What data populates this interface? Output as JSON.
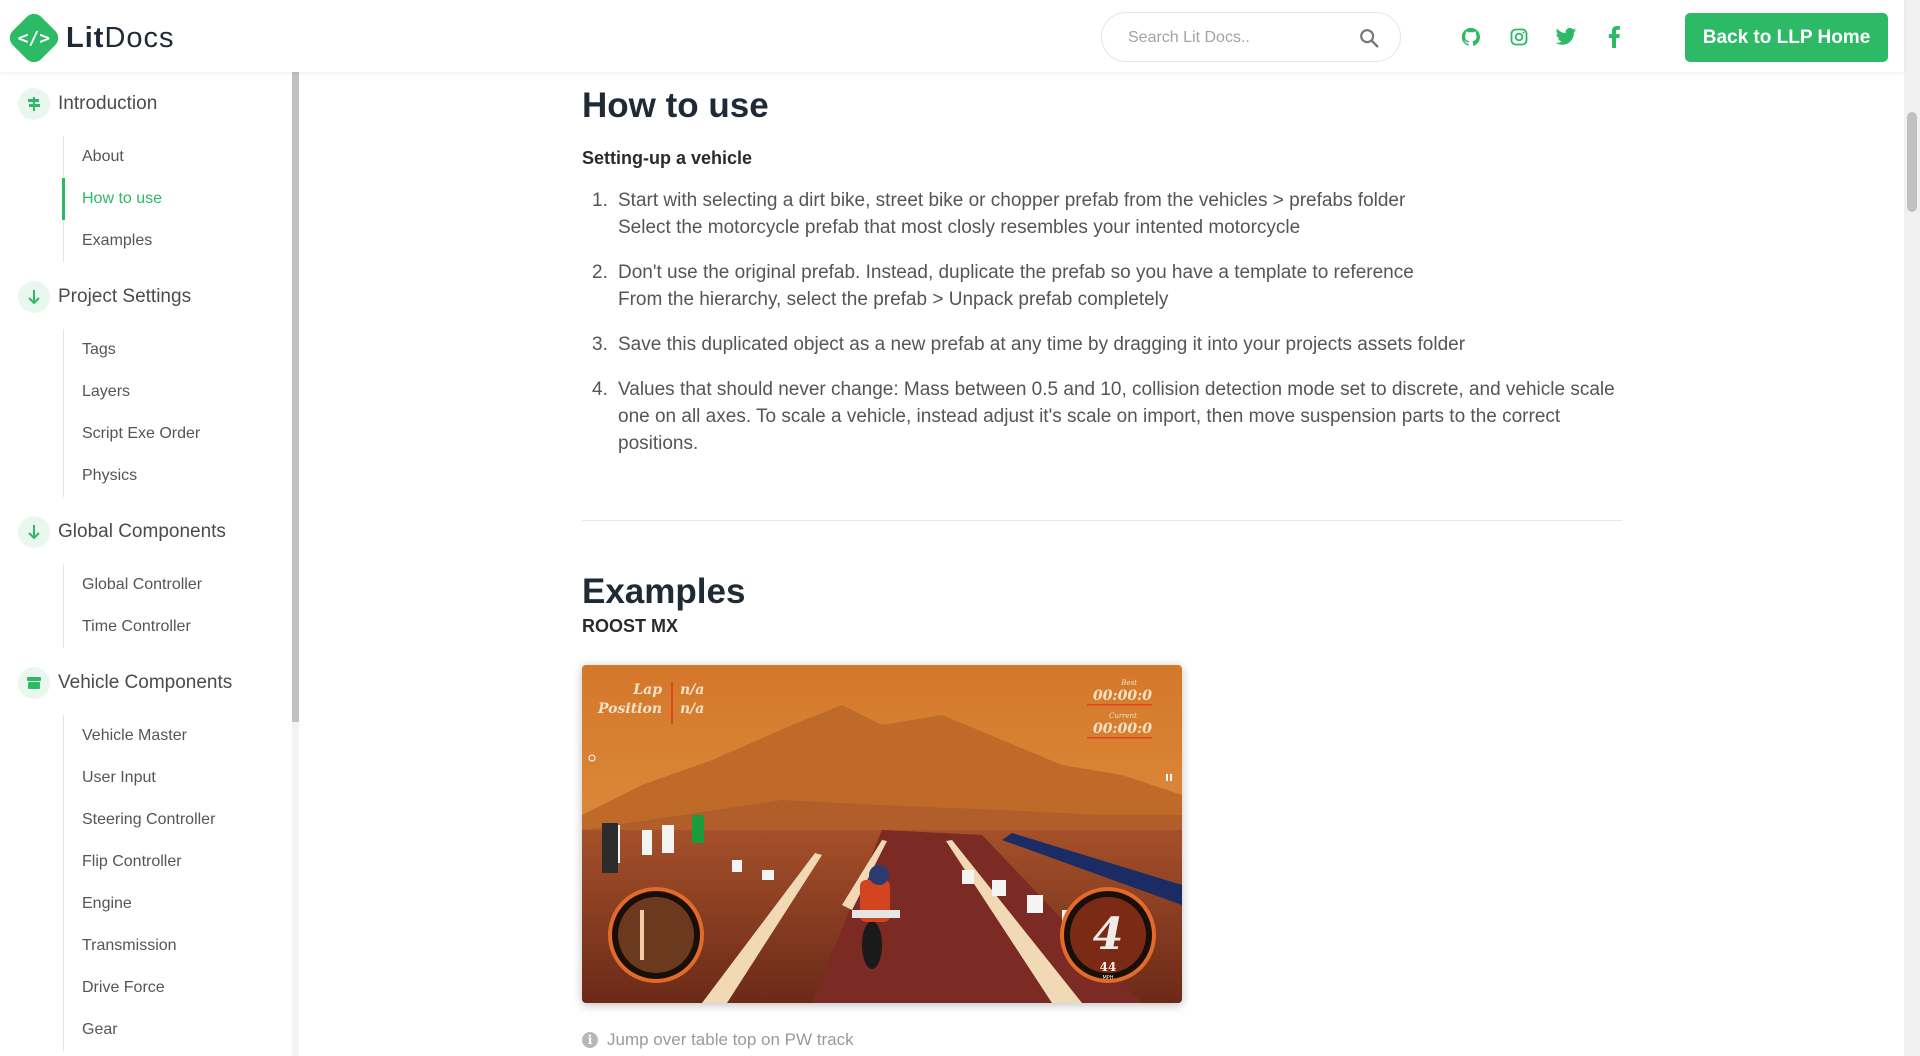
{
  "header": {
    "logo_symbol": "</>",
    "logo_bold": "Lit",
    "logo_light": "Docs",
    "search_placeholder": "Search Lit Docs..",
    "back_button": "Back to LLP Home",
    "social": [
      "github-icon",
      "instagram-icon",
      "twitter-icon",
      "facebook-icon"
    ],
    "accent": "#2cba66"
  },
  "sidebar": {
    "sections": [
      {
        "label": "Introduction",
        "icon": "signpost-icon",
        "items": [
          "About",
          "How to use",
          "Examples"
        ],
        "active_item": "How to use"
      },
      {
        "label": "Project Settings",
        "icon": "arrow-down-icon",
        "items": [
          "Tags",
          "Layers",
          "Script Exe Order",
          "Physics"
        ]
      },
      {
        "label": "Global Components",
        "icon": "arrow-down-icon",
        "items": [
          "Global Controller",
          "Time Controller"
        ]
      },
      {
        "label": "Vehicle Components",
        "icon": "box-icon",
        "items": [
          "Vehicle Master",
          "User Input",
          "Steering Controller",
          "Flip Controller",
          "Engine",
          "Transmission",
          "Drive Force",
          "Gear"
        ]
      }
    ]
  },
  "main": {
    "how_to_use": {
      "title": "How to use",
      "subtitle": "Setting-up a vehicle",
      "steps": [
        {
          "num": "1.",
          "lines": [
            "Start with selecting a dirt bike, street bike or chopper prefab from the vehicles > prefabs folder",
            "Select the motorcycle prefab that most closly resembles your intented motorcycle"
          ]
        },
        {
          "num": "2.",
          "lines": [
            "Don't use the original prefab. Instead, duplicate the prefab so you have a template to reference",
            "From the hierarchy, select the prefab > Unpack prefab completely"
          ]
        },
        {
          "num": "3.",
          "lines": [
            "Save this duplicated object as a new prefab at any time by dragging it into your projects assets folder"
          ]
        },
        {
          "num": "4.",
          "lines": [
            "Values that should never change: Mass between 0.5 and 10, collision detection mode set to discrete, and vehicle scale one on all axes. To scale a vehicle, instead adjust it's scale on import, then move suspension parts to the correct positions."
          ]
        }
      ]
    },
    "examples": {
      "title": "Examples",
      "subtitle": "ROOST MX",
      "hud": {
        "lap_label": "Lap",
        "lap_value": "n/a",
        "position_label": "Position",
        "position_value": "n/a",
        "best_label": "Best",
        "best_value": "00:00:0",
        "current_label": "Current",
        "current_value": "00:00:0",
        "gear": "4",
        "speed": "44",
        "speed_unit": "MPH"
      },
      "caption": "Jump over table top on PW track"
    }
  }
}
